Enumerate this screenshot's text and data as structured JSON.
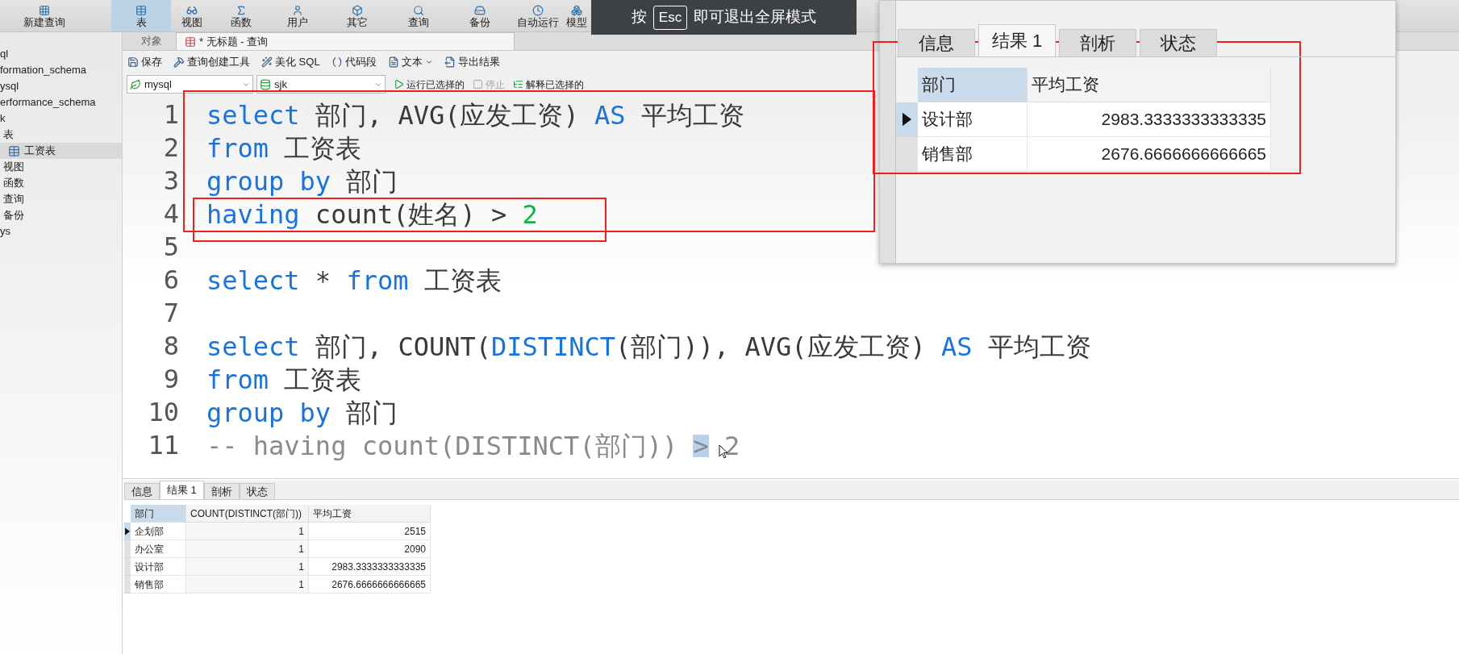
{
  "toolbar": {
    "items": [
      {
        "label": "新建查询",
        "selected": false
      },
      {
        "label": "表",
        "selected": true
      },
      {
        "label": "视图",
        "selected": false
      },
      {
        "label": "函数",
        "selected": false
      },
      {
        "label": "用户",
        "selected": false
      },
      {
        "label": "其它",
        "selected": false
      },
      {
        "label": "查询",
        "selected": false
      },
      {
        "label": "备份",
        "selected": false
      },
      {
        "label": "自动运行",
        "selected": false
      },
      {
        "label": "模型",
        "selected": false
      }
    ]
  },
  "esc_hint": {
    "prefix": "按",
    "key": "Esc",
    "suffix": "即可退出全屏模式"
  },
  "sidebar": {
    "items": [
      {
        "label": "ql",
        "selected": false
      },
      {
        "label": "formation_schema",
        "selected": false
      },
      {
        "label": "ysql",
        "selected": false
      },
      {
        "label": "erformance_schema",
        "selected": false
      },
      {
        "label": "k",
        "selected": false,
        "children": [
          {
            "label": "表",
            "selected": false,
            "children": [
              {
                "label": "工资表",
                "selected": true
              }
            ]
          },
          {
            "label": "视图",
            "selected": false
          },
          {
            "label": "函数",
            "selected": false
          },
          {
            "label": "查询",
            "selected": false
          },
          {
            "label": "备份",
            "selected": false
          }
        ]
      },
      {
        "label": "ys",
        "selected": false
      }
    ]
  },
  "object_tabs": [
    {
      "label": "对象",
      "selected": false
    },
    {
      "label": "* 无标题 - 查询",
      "selected": true
    }
  ],
  "query_toolbar": [
    {
      "label": "保存",
      "kind": "button"
    },
    {
      "label": "查询创建工具",
      "kind": "button"
    },
    {
      "label": "美化 SQL",
      "kind": "button"
    },
    {
      "label": "代码段",
      "kind": "button"
    },
    {
      "label": "文本",
      "kind": "dropdown"
    },
    {
      "label": "导出结果",
      "kind": "button"
    }
  ],
  "run_bar": {
    "connection": "mysql",
    "database": "sjk",
    "actions": [
      {
        "label": "运行已选择的",
        "disabled": false
      },
      {
        "label": "停止",
        "disabled": true
      },
      {
        "label": "解释已选择的",
        "disabled": false
      }
    ]
  },
  "editor": {
    "lines": [
      {
        "number": "1",
        "tokens": [
          {
            "text": "select",
            "kind": "keyword"
          },
          {
            "text": " 部门, AVG(应发工资) ",
            "kind": "plain"
          },
          {
            "text": "AS",
            "kind": "keyword"
          },
          {
            "text": " 平均工资",
            "kind": "plain"
          }
        ]
      },
      {
        "number": "2",
        "tokens": [
          {
            "text": "from",
            "kind": "keyword"
          },
          {
            "text": " 工资表",
            "kind": "plain"
          }
        ]
      },
      {
        "number": "3",
        "tokens": [
          {
            "text": "group by",
            "kind": "keyword"
          },
          {
            "text": " 部门",
            "kind": "plain"
          }
        ]
      },
      {
        "number": "4",
        "tokens": [
          {
            "text": "having",
            "kind": "keyword"
          },
          {
            "text": " count(姓名) > ",
            "kind": "plain"
          },
          {
            "text": "2",
            "kind": "number"
          }
        ]
      },
      {
        "number": "5"
      },
      {
        "number": "6",
        "tokens": [
          {
            "text": "select",
            "kind": "keyword"
          },
          {
            "text": " * ",
            "kind": "plain"
          },
          {
            "text": "from",
            "kind": "keyword"
          },
          {
            "text": " 工资表",
            "kind": "plain"
          }
        ]
      },
      {
        "number": "7"
      },
      {
        "number": "8",
        "tokens": [
          {
            "text": "select",
            "kind": "keyword"
          },
          {
            "text": " 部门, COUNT(",
            "kind": "plain"
          },
          {
            "text": "DISTINCT",
            "kind": "keyword"
          },
          {
            "text": "(部门)), AVG(应发工资) ",
            "kind": "plain"
          },
          {
            "text": "AS",
            "kind": "keyword"
          },
          {
            "text": " 平均工资",
            "kind": "plain"
          }
        ]
      },
      {
        "number": "9",
        "tokens": [
          {
            "text": "from",
            "kind": "keyword"
          },
          {
            "text": " 工资表",
            "kind": "plain"
          }
        ]
      },
      {
        "number": "10",
        "tokens": [
          {
            "text": "group by",
            "kind": "keyword"
          },
          {
            "text": " 部门",
            "kind": "plain"
          }
        ]
      },
      {
        "number": "11",
        "tokens": [
          {
            "text": "-- having count(DISTINCT(部门)) ",
            "kind": "comment"
          },
          {
            "text": ">",
            "kind": "highlight"
          },
          {
            "text": " 2",
            "kind": "comment"
          }
        ]
      }
    ]
  },
  "results": {
    "tabs": [
      {
        "label": "信息",
        "selected": false
      },
      {
        "label": "结果 1",
        "selected": true
      },
      {
        "label": "剖析",
        "selected": false
      },
      {
        "label": "状态",
        "selected": false
      }
    ],
    "columns": [
      "部门",
      "COUNT(DISTINCT(部门))",
      "平均工资"
    ],
    "rows": [
      {
        "selected": true,
        "cells": [
          "企划部",
          "1",
          "2515"
        ]
      },
      {
        "selected": false,
        "cells": [
          "办公室",
          "1",
          "2090"
        ]
      },
      {
        "selected": false,
        "cells": [
          "设计部",
          "1",
          "2983.3333333333335"
        ]
      },
      {
        "selected": false,
        "cells": [
          "销售部",
          "1",
          "2676.6666666666665"
        ]
      }
    ]
  },
  "popup": {
    "tabs": [
      {
        "label": "信息",
        "selected": false
      },
      {
        "label": "结果 1",
        "selected": true
      },
      {
        "label": "剖析",
        "selected": false
      },
      {
        "label": "状态",
        "selected": false
      }
    ],
    "columns": [
      "部门",
      "平均工资"
    ],
    "rows": [
      {
        "selected": true,
        "cells": [
          "设计部",
          "2983.3333333333335"
        ]
      },
      {
        "selected": false,
        "cells": [
          "销售部",
          "2676.6666666666665"
        ]
      }
    ]
  }
}
